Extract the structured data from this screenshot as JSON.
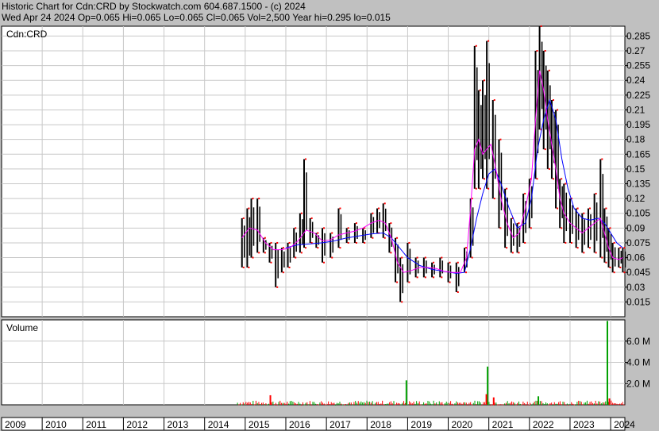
{
  "header": {
    "line1": "Historic Chart for Cdn:CRD by Stockwatch.com 604.687.1500 - (c) 2024",
    "line2": "Wed Apr 24 2024   Op=0.065  Hi=0.065  Lo=0.065  Cl=0.065  Vol=2,500   Year hi=0.295  lo=0.015"
  },
  "chart_data": [
    {
      "type": "line",
      "panel": "price",
      "label": "Cdn:CRD",
      "x_label": "Year",
      "x_categories": [
        "2009",
        "2010",
        "2011",
        "2012",
        "2013",
        "2014",
        "2015",
        "2016",
        "2017",
        "2018",
        "2019",
        "2020",
        "2021",
        "2022",
        "2023",
        "2024"
      ],
      "y_ticks": [
        0.015,
        0.03,
        0.045,
        0.06,
        0.075,
        0.09,
        0.105,
        0.12,
        0.135,
        0.15,
        0.165,
        0.18,
        0.195,
        0.21,
        0.225,
        0.24,
        0.255,
        0.27,
        0.285
      ],
      "ylim": [
        0.0,
        0.295
      ],
      "xlim": [
        2009.0,
        2024.35
      ],
      "grid": true,
      "y_axis_side": "right",
      "colors": {
        "bars": "#000000",
        "ma_short": "#ff00ff",
        "ma_long": "#0000ff",
        "dots": "#ff0000"
      },
      "price_range_points": [
        {
          "x": 2014.92,
          "low": 0.05,
          "high": 0.1
        },
        {
          "x": 2015.05,
          "low": 0.05,
          "high": 0.11
        },
        {
          "x": 2015.15,
          "low": 0.06,
          "high": 0.12
        },
        {
          "x": 2015.3,
          "low": 0.065,
          "high": 0.12
        },
        {
          "x": 2015.45,
          "low": 0.065,
          "high": 0.08
        },
        {
          "x": 2015.6,
          "low": 0.055,
          "high": 0.075
        },
        {
          "x": 2015.75,
          "low": 0.03,
          "high": 0.075
        },
        {
          "x": 2015.9,
          "low": 0.045,
          "high": 0.07
        },
        {
          "x": 2016.05,
          "low": 0.05,
          "high": 0.075
        },
        {
          "x": 2016.2,
          "low": 0.06,
          "high": 0.09
        },
        {
          "x": 2016.35,
          "low": 0.065,
          "high": 0.105
        },
        {
          "x": 2016.45,
          "low": 0.07,
          "high": 0.16
        },
        {
          "x": 2016.6,
          "low": 0.075,
          "high": 0.1
        },
        {
          "x": 2016.75,
          "low": 0.07,
          "high": 0.085
        },
        {
          "x": 2016.9,
          "low": 0.055,
          "high": 0.09
        },
        {
          "x": 2017.1,
          "low": 0.06,
          "high": 0.085
        },
        {
          "x": 2017.3,
          "low": 0.07,
          "high": 0.11
        },
        {
          "x": 2017.5,
          "low": 0.075,
          "high": 0.09
        },
        {
          "x": 2017.7,
          "low": 0.075,
          "high": 0.095
        },
        {
          "x": 2017.9,
          "low": 0.075,
          "high": 0.09
        },
        {
          "x": 2018.1,
          "low": 0.08,
          "high": 0.105
        },
        {
          "x": 2018.25,
          "low": 0.085,
          "high": 0.11
        },
        {
          "x": 2018.4,
          "low": 0.08,
          "high": 0.115
        },
        {
          "x": 2018.55,
          "low": 0.065,
          "high": 0.095
        },
        {
          "x": 2018.7,
          "low": 0.035,
          "high": 0.08
        },
        {
          "x": 2018.82,
          "low": 0.015,
          "high": 0.06
        },
        {
          "x": 2019.0,
          "low": 0.035,
          "high": 0.075
        },
        {
          "x": 2019.2,
          "low": 0.04,
          "high": 0.06
        },
        {
          "x": 2019.4,
          "low": 0.04,
          "high": 0.06
        },
        {
          "x": 2019.6,
          "low": 0.04,
          "high": 0.055
        },
        {
          "x": 2019.8,
          "low": 0.04,
          "high": 0.06
        },
        {
          "x": 2020.0,
          "low": 0.035,
          "high": 0.055
        },
        {
          "x": 2020.2,
          "low": 0.025,
          "high": 0.055
        },
        {
          "x": 2020.4,
          "low": 0.045,
          "high": 0.07
        },
        {
          "x": 2020.55,
          "low": 0.06,
          "high": 0.12
        },
        {
          "x": 2020.65,
          "low": 0.13,
          "high": 0.275
        },
        {
          "x": 2020.75,
          "low": 0.13,
          "high": 0.23
        },
        {
          "x": 2020.85,
          "low": 0.14,
          "high": 0.24
        },
        {
          "x": 2020.95,
          "low": 0.13,
          "high": 0.28
        },
        {
          "x": 2021.1,
          "low": 0.12,
          "high": 0.22
        },
        {
          "x": 2021.25,
          "low": 0.09,
          "high": 0.18
        },
        {
          "x": 2021.4,
          "low": 0.07,
          "high": 0.13
        },
        {
          "x": 2021.55,
          "low": 0.065,
          "high": 0.1
        },
        {
          "x": 2021.7,
          "low": 0.065,
          "high": 0.095
        },
        {
          "x": 2021.85,
          "low": 0.075,
          "high": 0.125
        },
        {
          "x": 2022.0,
          "low": 0.09,
          "high": 0.14
        },
        {
          "x": 2022.15,
          "low": 0.14,
          "high": 0.27
        },
        {
          "x": 2022.25,
          "low": 0.19,
          "high": 0.295
        },
        {
          "x": 2022.35,
          "low": 0.17,
          "high": 0.27
        },
        {
          "x": 2022.45,
          "low": 0.15,
          "high": 0.25
        },
        {
          "x": 2022.55,
          "low": 0.14,
          "high": 0.22
        },
        {
          "x": 2022.65,
          "low": 0.11,
          "high": 0.21
        },
        {
          "x": 2022.75,
          "low": 0.09,
          "high": 0.14
        },
        {
          "x": 2022.85,
          "low": 0.075,
          "high": 0.135
        },
        {
          "x": 2023.0,
          "low": 0.075,
          "high": 0.12
        },
        {
          "x": 2023.15,
          "low": 0.07,
          "high": 0.11
        },
        {
          "x": 2023.3,
          "low": 0.065,
          "high": 0.105
        },
        {
          "x": 2023.45,
          "low": 0.07,
          "high": 0.11
        },
        {
          "x": 2023.6,
          "low": 0.065,
          "high": 0.125
        },
        {
          "x": 2023.75,
          "low": 0.06,
          "high": 0.16
        },
        {
          "x": 2023.85,
          "low": 0.055,
          "high": 0.11
        },
        {
          "x": 2023.95,
          "low": 0.05,
          "high": 0.09
        },
        {
          "x": 2024.05,
          "low": 0.045,
          "high": 0.075
        },
        {
          "x": 2024.2,
          "low": 0.05,
          "high": 0.07
        },
        {
          "x": 2024.3,
          "low": 0.045,
          "high": 0.07
        }
      ],
      "ma_short": [
        [
          2014.92,
          0.08
        ],
        [
          2015.1,
          0.09
        ],
        [
          2015.3,
          0.088
        ],
        [
          2015.5,
          0.075
        ],
        [
          2015.7,
          0.068
        ],
        [
          2015.9,
          0.068
        ],
        [
          2016.1,
          0.07
        ],
        [
          2016.3,
          0.077
        ],
        [
          2016.5,
          0.088
        ],
        [
          2016.7,
          0.085
        ],
        [
          2016.9,
          0.077
        ],
        [
          2017.1,
          0.078
        ],
        [
          2017.3,
          0.083
        ],
        [
          2017.5,
          0.085
        ],
        [
          2017.7,
          0.087
        ],
        [
          2017.9,
          0.09
        ],
        [
          2018.1,
          0.095
        ],
        [
          2018.3,
          0.098
        ],
        [
          2018.45,
          0.095
        ],
        [
          2018.6,
          0.08
        ],
        [
          2018.75,
          0.055
        ],
        [
          2018.9,
          0.045
        ],
        [
          2019.1,
          0.047
        ],
        [
          2019.3,
          0.05
        ],
        [
          2019.5,
          0.05
        ],
        [
          2019.7,
          0.049
        ],
        [
          2019.9,
          0.046
        ],
        [
          2020.1,
          0.045
        ],
        [
          2020.3,
          0.045
        ],
        [
          2020.45,
          0.06
        ],
        [
          2020.55,
          0.11
        ],
        [
          2020.65,
          0.17
        ],
        [
          2020.75,
          0.18
        ],
        [
          2020.85,
          0.165
        ],
        [
          2020.95,
          0.17
        ],
        [
          2021.05,
          0.175
        ],
        [
          2021.15,
          0.155
        ],
        [
          2021.3,
          0.12
        ],
        [
          2021.45,
          0.095
        ],
        [
          2021.6,
          0.08
        ],
        [
          2021.75,
          0.085
        ],
        [
          2021.9,
          0.11
        ],
        [
          2022.05,
          0.14
        ],
        [
          2022.15,
          0.2
        ],
        [
          2022.25,
          0.25
        ],
        [
          2022.35,
          0.23
        ],
        [
          2022.45,
          0.2
        ],
        [
          2022.55,
          0.175
        ],
        [
          2022.65,
          0.15
        ],
        [
          2022.75,
          0.12
        ],
        [
          2022.85,
          0.105
        ],
        [
          2023.0,
          0.095
        ],
        [
          2023.15,
          0.09
        ],
        [
          2023.3,
          0.085
        ],
        [
          2023.45,
          0.09
        ],
        [
          2023.6,
          0.095
        ],
        [
          2023.75,
          0.1
        ],
        [
          2023.85,
          0.085
        ],
        [
          2023.95,
          0.07
        ],
        [
          2024.05,
          0.06
        ],
        [
          2024.2,
          0.058
        ],
        [
          2024.3,
          0.06
        ]
      ],
      "ma_long": [
        [
          2016.0,
          0.07
        ],
        [
          2016.3,
          0.073
        ],
        [
          2016.6,
          0.074
        ],
        [
          2016.9,
          0.075
        ],
        [
          2017.2,
          0.077
        ],
        [
          2017.5,
          0.08
        ],
        [
          2017.8,
          0.082
        ],
        [
          2018.1,
          0.084
        ],
        [
          2018.4,
          0.085
        ],
        [
          2018.6,
          0.08
        ],
        [
          2018.8,
          0.07
        ],
        [
          2019.0,
          0.06
        ],
        [
          2019.3,
          0.052
        ],
        [
          2019.6,
          0.048
        ],
        [
          2019.9,
          0.046
        ],
        [
          2020.2,
          0.044
        ],
        [
          2020.4,
          0.045
        ],
        [
          2020.55,
          0.07
        ],
        [
          2020.7,
          0.1
        ],
        [
          2020.85,
          0.125
        ],
        [
          2021.0,
          0.145
        ],
        [
          2021.15,
          0.15
        ],
        [
          2021.3,
          0.135
        ],
        [
          2021.5,
          0.11
        ],
        [
          2021.7,
          0.09
        ],
        [
          2021.9,
          0.095
        ],
        [
          2022.05,
          0.12
        ],
        [
          2022.2,
          0.17
        ],
        [
          2022.35,
          0.2
        ],
        [
          2022.5,
          0.22
        ],
        [
          2022.65,
          0.2
        ],
        [
          2022.8,
          0.16
        ],
        [
          2022.95,
          0.13
        ],
        [
          2023.1,
          0.11
        ],
        [
          2023.3,
          0.1
        ],
        [
          2023.5,
          0.098
        ],
        [
          2023.7,
          0.1
        ],
        [
          2023.85,
          0.095
        ],
        [
          2024.0,
          0.085
        ],
        [
          2024.15,
          0.075
        ],
        [
          2024.3,
          0.07
        ]
      ]
    },
    {
      "type": "bar",
      "panel": "volume",
      "label": "Volume",
      "y_ticks": [
        "2.0 M",
        "4.0 M",
        "6.0 M"
      ],
      "y_tick_values": [
        2000000,
        4000000,
        6000000
      ],
      "ylim": [
        0,
        8000000
      ],
      "colors": {
        "up": "#00a000",
        "down": "#ff0000"
      },
      "notable_bars": [
        {
          "x": 2015.6,
          "value": 900000,
          "color": "down"
        },
        {
          "x": 2018.95,
          "value": 2300000,
          "color": "up"
        },
        {
          "x": 2020.95,
          "value": 3600000,
          "color": "up"
        },
        {
          "x": 2020.92,
          "value": 1000000,
          "color": "down"
        },
        {
          "x": 2021.1,
          "value": 700000,
          "color": "down"
        },
        {
          "x": 2022.2,
          "value": 800000,
          "color": "up"
        },
        {
          "x": 2023.9,
          "value": 7900000,
          "color": "up"
        },
        {
          "x": 2023.95,
          "value": 600000,
          "color": "down"
        }
      ],
      "baseline_range": [
        2014.8,
        2024.35
      ],
      "baseline_max": 400000
    }
  ]
}
